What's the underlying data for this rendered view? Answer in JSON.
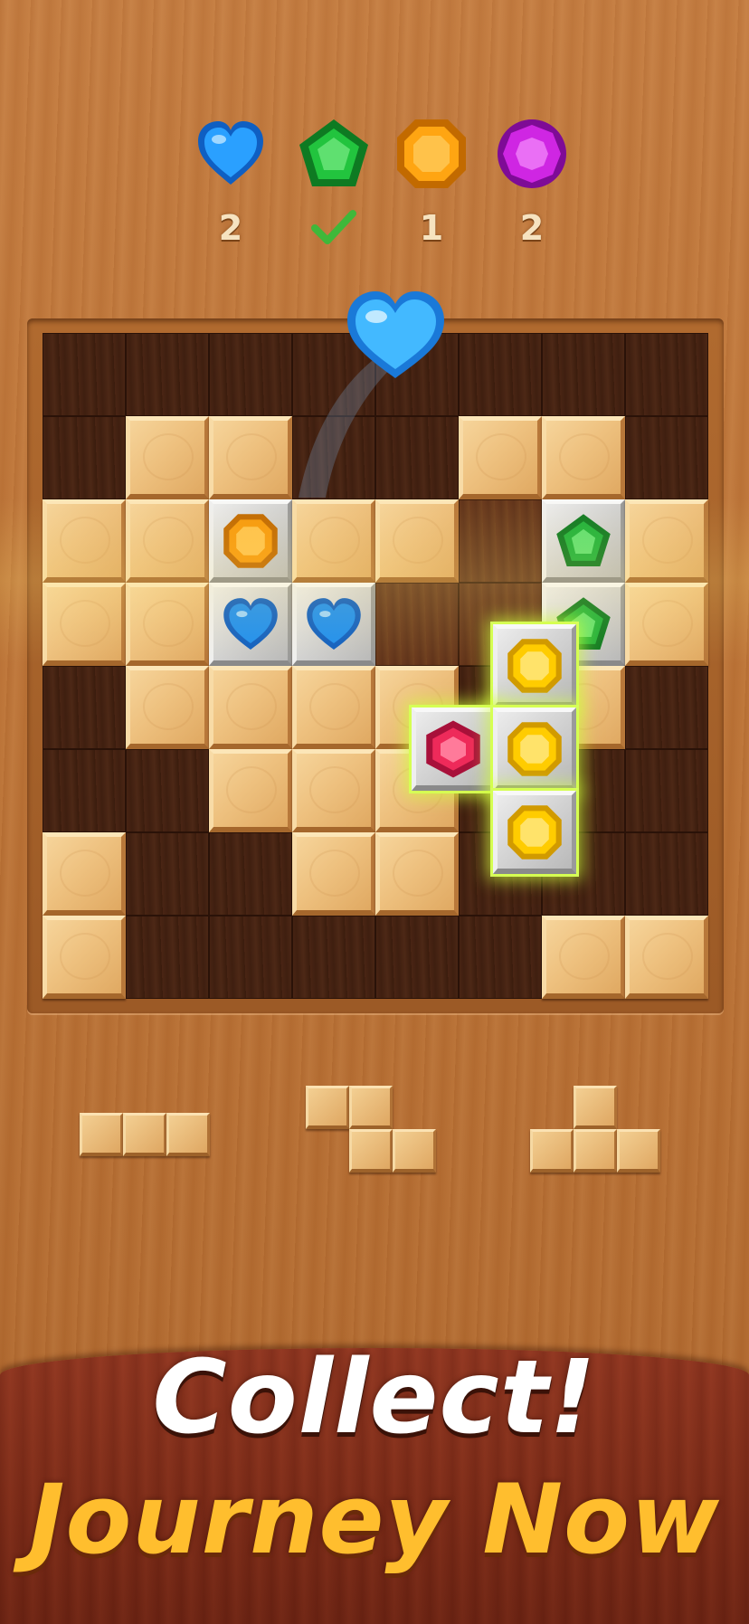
{
  "goals": [
    {
      "gem": "blue-heart",
      "count": "2",
      "done": false
    },
    {
      "gem": "green-pentagon",
      "count": "",
      "done": true
    },
    {
      "gem": "orange-octagon",
      "count": "1",
      "done": false
    },
    {
      "gem": "purple-round",
      "count": "2",
      "done": false
    }
  ],
  "board": {
    "rows": 8,
    "cols": 8,
    "grid": [
      [
        "",
        "",
        "",
        "",
        "",
        "",
        "",
        ""
      ],
      [
        "",
        "W",
        "W",
        "",
        "",
        "W",
        "W",
        ""
      ],
      [
        "W",
        "W",
        "S:orange-octagon",
        "W",
        "W",
        "L",
        "S:green-pentagon",
        "W"
      ],
      [
        "W",
        "W",
        "S:blue-heart",
        "S:blue-heart",
        "L",
        "L",
        "S:green-pentagon",
        "W"
      ],
      [
        "",
        "W",
        "W",
        "W",
        "W",
        "",
        "W",
        ""
      ],
      [
        "",
        "",
        "W",
        "W",
        "W",
        "",
        "",
        ""
      ],
      [
        "W",
        "",
        "",
        "W",
        "W",
        "",
        "",
        ""
      ],
      [
        "W",
        "",
        "",
        "",
        "",
        "",
        "W",
        "W"
      ]
    ]
  },
  "dragged_piece": [
    "red-hexagon",
    "yellow-octagon",
    "yellow-octagon",
    "yellow-octagon"
  ],
  "flying_gem": "blue-heart",
  "tray_pieces": [
    "line-3",
    "z-shape",
    "t-shape"
  ],
  "colors": {
    "blue-heart": "#1e8ff0",
    "green-pentagon": "#1fb23a",
    "orange-octagon": "#f79a0c",
    "yellow-octagon": "#ffcc00",
    "purple-round": "#c21fd6",
    "red-hexagon": "#ee2a5a",
    "check": "#3fb83a"
  },
  "banner": {
    "headline": "Collect!",
    "subline": "Journey Now"
  }
}
